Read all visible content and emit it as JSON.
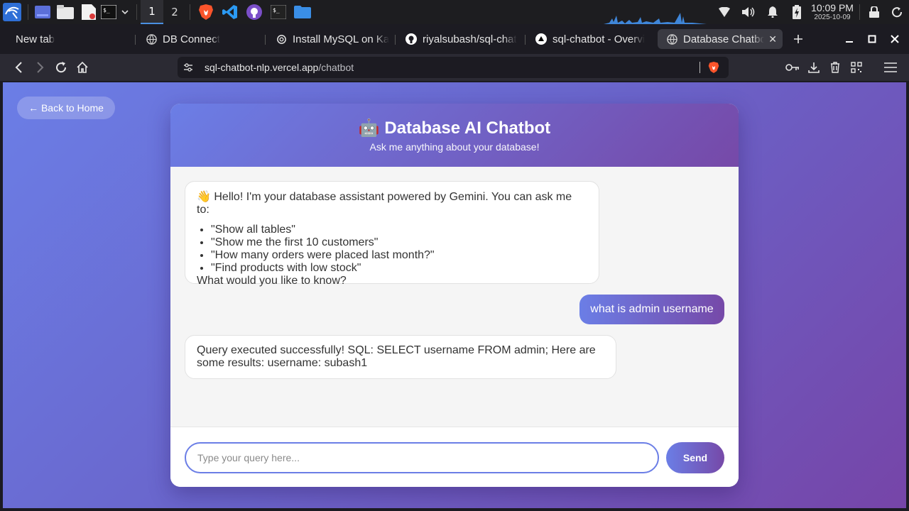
{
  "taskbar": {
    "workspaces": [
      "1",
      "2"
    ],
    "clock_time": "10:09 PM",
    "clock_date": "2025-10-09"
  },
  "tabs": [
    {
      "label": "New tab"
    },
    {
      "label": "DB Connect"
    },
    {
      "label": "Install MySQL on Ka"
    },
    {
      "label": "riyalsubash/sql-chat"
    },
    {
      "label": "sql-chatbot - Overvi"
    },
    {
      "label": "Database Chatbot"
    }
  ],
  "address_bar": {
    "host": "sql-chatbot-nlp.vercel.app",
    "path": "/chatbot"
  },
  "page": {
    "back_label": "← Back to Home",
    "title": "🤖 Database AI Chatbot",
    "subtitle": "Ask me anything about your database!",
    "welcome": {
      "intro": "👋 Hello! I'm your database assistant powered by Gemini. You can ask me to:",
      "examples": [
        "\"Show all tables\"",
        "\"Show me the first 10 customers\"",
        "\"How many orders were placed last month?\"",
        "\"Find products with low stock\""
      ],
      "outro": "What would you like to know?"
    },
    "user_message": "what is admin username",
    "bot_reply": "Query executed successfully! SQL: SELECT username FROM admin; Here are some results: username: subash1",
    "input_placeholder": "Type your query here...",
    "send_label": "Send"
  },
  "colors": {
    "accent_start": "#6b7ee6",
    "accent_end": "#7649a8"
  }
}
